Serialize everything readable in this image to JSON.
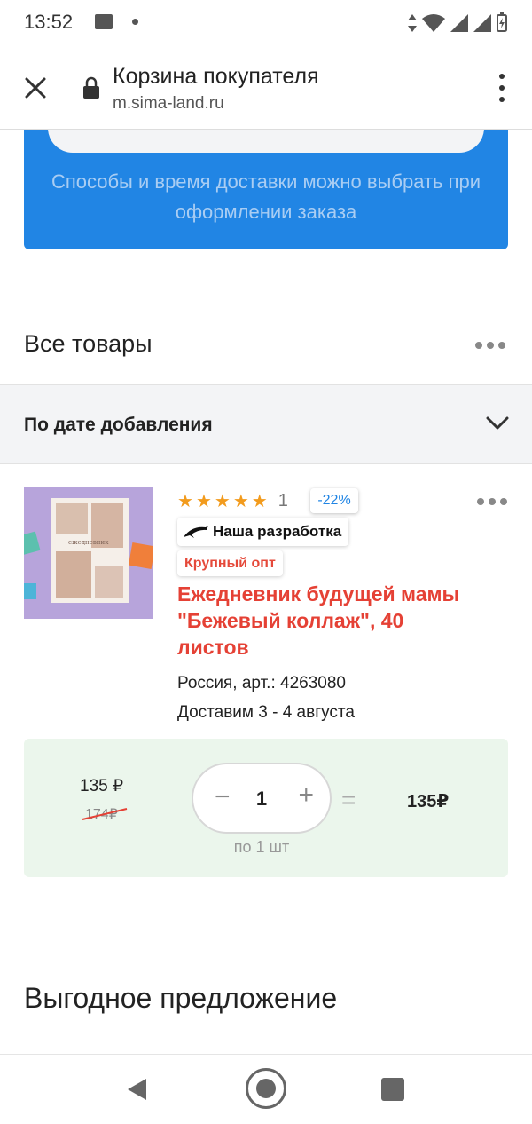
{
  "status_bar": {
    "time": "13:52"
  },
  "browser": {
    "title": "Корзина покупателя",
    "url": "m.sima-land.ru"
  },
  "banner": {
    "text": "Способы и время доставки можно выбрать при оформлении заказа"
  },
  "section": {
    "title": "Все товары"
  },
  "sort": {
    "label": "По дате добавления"
  },
  "product": {
    "rating_count": "1",
    "discount": "-22%",
    "badge_own": "Наша разработка",
    "badge_wholesale": "Крупный опт",
    "title": "Ежедневник будущей мамы \"Бежевый коллаж\", 40 листов",
    "origin": "Россия, арт.: 4263080",
    "delivery": "Доставим 3 - 4 августа",
    "price_now": "135 ₽",
    "price_old": "174₽",
    "quantity": "1",
    "per_unit": "по 1 шт",
    "equals": "=",
    "total": "135₽",
    "rating_stars": 5
  },
  "offer": {
    "title": "Выгодное предложение"
  },
  "colors": {
    "accent_blue": "#2185e4",
    "title_red": "#e54135",
    "star_orange": "#f29b1d",
    "price_bg": "#ebf6ec"
  }
}
